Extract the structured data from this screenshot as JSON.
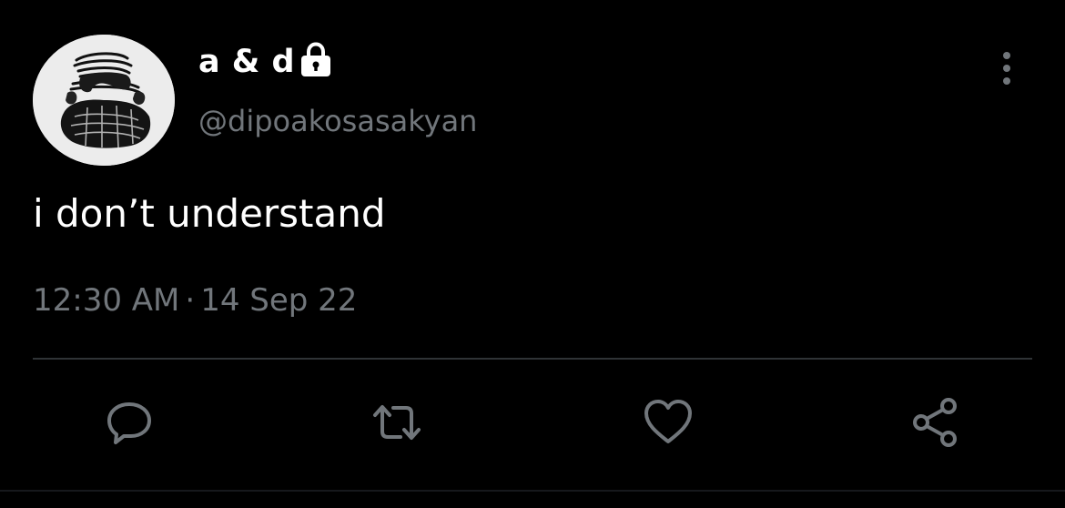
{
  "author": {
    "display_name": "a & d",
    "handle": "@dipoakosasakyan",
    "protected": true
  },
  "icons": {
    "avatar": "avatar-image",
    "lock": "lock-icon",
    "more": "more-vertical-icon",
    "reply": "reply-icon",
    "retweet": "retweet-icon",
    "like": "heart-icon",
    "share": "share-icon"
  },
  "tweet": {
    "text": "i don’t understand",
    "time": "12:30 AM",
    "separator": "·",
    "date": "14 Sep 22"
  },
  "colors": {
    "background": "#000000",
    "primary_text": "#ffffff",
    "secondary_text": "#71767b",
    "divider": "#2f3336"
  }
}
